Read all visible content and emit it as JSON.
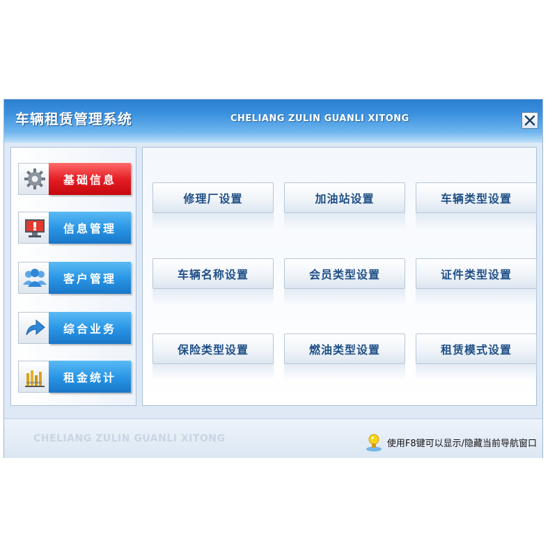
{
  "window": {
    "title": "车辆租赁管理系统",
    "subtitle_en": "CHELIANG ZULIN GUANLI XITONG",
    "close_icon": "close-icon"
  },
  "sidebar": {
    "items": [
      {
        "label": "基础信息",
        "icon": "gear-icon",
        "active": true
      },
      {
        "label": "信息管理",
        "icon": "monitor-alert-icon",
        "active": false
      },
      {
        "label": "客户管理",
        "icon": "users-icon",
        "active": false
      },
      {
        "label": "综合业务",
        "icon": "forward-arrow-icon",
        "active": false
      },
      {
        "label": "租金统计",
        "icon": "bar-chart-icon",
        "active": false
      }
    ]
  },
  "main": {
    "buttons": [
      {
        "label": "修理厂设置"
      },
      {
        "label": "加油站设置"
      },
      {
        "label": "车辆类型设置"
      },
      {
        "label": "车辆名称设置"
      },
      {
        "label": "会员类型设置"
      },
      {
        "label": "证件类型设置"
      },
      {
        "label": "保险类型设置"
      },
      {
        "label": "燃油类型设置"
      },
      {
        "label": "租赁模式设置"
      }
    ]
  },
  "status": {
    "watermark": "CHELIANG ZULIN GUANLI XITONG",
    "hint": "使用F8键可以显示/隐藏当前导航窗口",
    "hint_icon": "lightbulb-icon"
  },
  "colors": {
    "accent_blue": "#2a97e6",
    "active_red": "#e41f25",
    "button_text": "#1f4f86"
  }
}
